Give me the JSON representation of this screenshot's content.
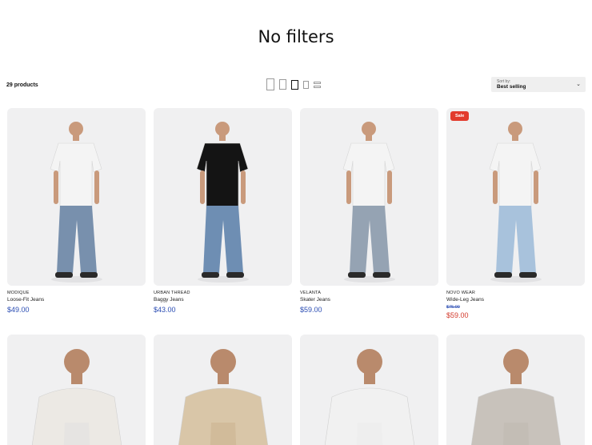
{
  "page": {
    "title": "No filters"
  },
  "toolbar": {
    "product_count": "29 products",
    "layouts": [
      {
        "icon": "layout-single-column-icon",
        "active": false
      },
      {
        "icon": "layout-two-column-icon",
        "active": false
      },
      {
        "icon": "layout-three-column-icon",
        "active": true
      },
      {
        "icon": "layout-four-column-icon",
        "active": false
      },
      {
        "icon": "layout-list-icon",
        "active": false
      }
    ],
    "sort": {
      "caption": "Sort by:",
      "value": "Best selling",
      "icon": "chevron-down-icon"
    }
  },
  "products": [
    {
      "brand": "MODIQUE",
      "name": "Loose-Fit Jeans",
      "price": "$49.00",
      "sale": false,
      "shirt_color": "#f4f4f4",
      "pants_color": "#7890ad"
    },
    {
      "brand": "URBAN THREAD",
      "name": "Baggy Jeans",
      "price": "$43.00",
      "sale": false,
      "shirt_color": "#141414",
      "pants_color": "#6e8eb3"
    },
    {
      "brand": "VELANTA",
      "name": "Skater Jeans",
      "price": "$59.00",
      "sale": false,
      "shirt_color": "#f4f4f4",
      "pants_color": "#95a3b3"
    },
    {
      "brand": "NOVO WEAR",
      "name": "Wide-Leg Jeans",
      "compare_price": "$75.00",
      "price": "$59.00",
      "sale": true,
      "badge": "Sale",
      "shirt_color": "#f4f4f4",
      "pants_color": "#a8c2dc"
    },
    {
      "shirt_color": "#ece9e4",
      "pants_color": "#e0e0e0"
    },
    {
      "shirt_color": "#d9c6a8",
      "pants_color": "#c9b08c"
    },
    {
      "shirt_color": "#f1f1f1",
      "pants_color": "#ececec"
    },
    {
      "shirt_color": "#c8c2bb",
      "pants_color": "#bdb7b0"
    }
  ]
}
